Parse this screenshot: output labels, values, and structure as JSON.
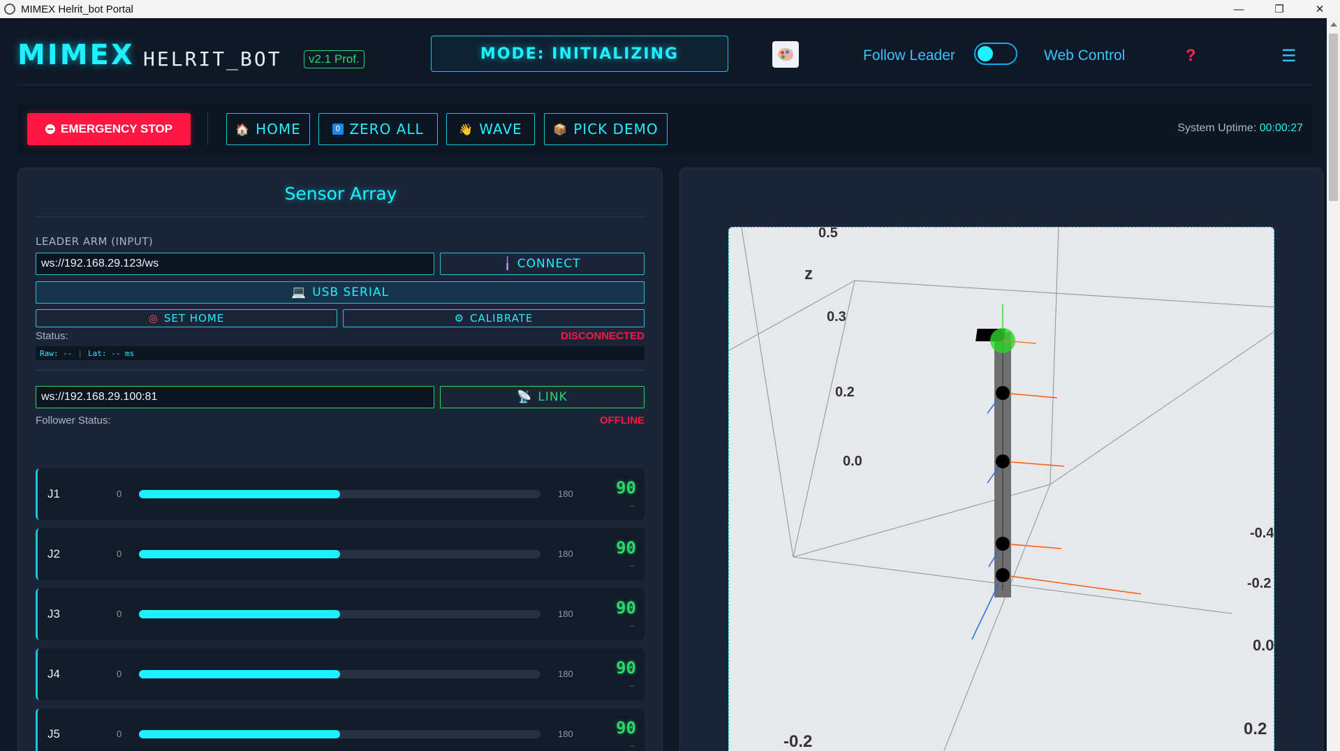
{
  "window": {
    "title": "MIMEX Helrit_bot Portal",
    "controls": {
      "minimize": "—",
      "restore": "❐",
      "close": "✕"
    }
  },
  "header": {
    "logo": "MIMEX",
    "subtitle": "HELRIT_BOT",
    "version": "v2.1 Prof.",
    "mode": "MODE: INITIALIZING",
    "follow_label": "Follow Leader",
    "follow_enabled": false,
    "web_label": "Web Control",
    "help": "?",
    "menu": "☰"
  },
  "toolbar": {
    "estop": "EMERGENCY STOP",
    "home": "HOME",
    "zero_all": "ZERO ALL",
    "wave": "WAVE",
    "pick_demo": "PICK DEMO",
    "uptime_label": "System Uptime:",
    "uptime_value": "00:00:27"
  },
  "sensor": {
    "title": "Sensor Array",
    "leader_label": "LEADER ARM (INPUT)",
    "leader_url": "ws://192.168.29.123/ws",
    "connect": "CONNECT",
    "usb": "USB SERIAL",
    "set_home": "SET HOME",
    "calibrate": "CALIBRATE",
    "status_label": "Status:",
    "status_value": "DISCONNECTED",
    "raw": "Raw: --",
    "sep": "|",
    "lat": "Lat: -- ms",
    "follower_url": "ws://192.168.29.100:81",
    "link": "LINK",
    "follower_label": "Follower Status:",
    "follower_value": "OFFLINE"
  },
  "joints": [
    {
      "name": "J1",
      "min": "0",
      "max": "180",
      "value": "90",
      "sub": "--",
      "fraction": 0.5
    },
    {
      "name": "J2",
      "min": "0",
      "max": "180",
      "value": "90",
      "sub": "--",
      "fraction": 0.5
    },
    {
      "name": "J3",
      "min": "0",
      "max": "180",
      "value": "90",
      "sub": "--",
      "fraction": 0.5
    },
    {
      "name": "J4",
      "min": "0",
      "max": "180",
      "value": "90",
      "sub": "--",
      "fraction": 0.5
    },
    {
      "name": "J5",
      "min": "0",
      "max": "180",
      "value": "90",
      "sub": "--",
      "fraction": 0.5
    }
  ],
  "plot3d": {
    "z_axis_label": "z",
    "z_ticks": [
      "0.5",
      "0.3",
      "0.2",
      "0.0"
    ],
    "right_ticks": [
      "-0.4",
      "-0.2",
      "0.0",
      "0.2"
    ],
    "bottom_tick": "-0.2"
  },
  "colors": {
    "accent": "#1ff0ff",
    "success": "#2bd66a",
    "danger": "#ff1744",
    "panel": "#1a2637"
  }
}
